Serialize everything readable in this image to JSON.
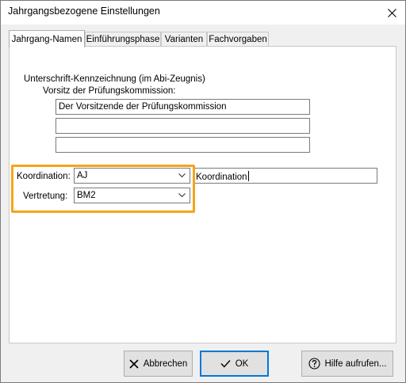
{
  "window": {
    "title": "Jahrgangsbezogene Einstellungen"
  },
  "tabs": [
    {
      "label": "Jahrgang-Namen"
    },
    {
      "label": "Einführungsphase"
    },
    {
      "label": "Varianten"
    },
    {
      "label": "Fachvorgaben"
    }
  ],
  "signature": {
    "section_label": "Unterschrift-Kennzeichnung (im Abi-Zeugnis)",
    "sub_label": "Vorsitz der Prüfungskommission:",
    "lines": [
      "Der Vorsitzende der Prüfungskommission",
      "",
      ""
    ]
  },
  "coordination": {
    "koordination_label": "Koordination:",
    "koordination_value": "AJ",
    "koordination_text": "Koordination",
    "vertretung_label": "Vertretung:",
    "vertretung_value": "BM2",
    "highlight_color": "#f4a518"
  },
  "buttons": {
    "cancel": "Abbrechen",
    "ok": "OK",
    "help": "Hilfe aufrufen..."
  }
}
